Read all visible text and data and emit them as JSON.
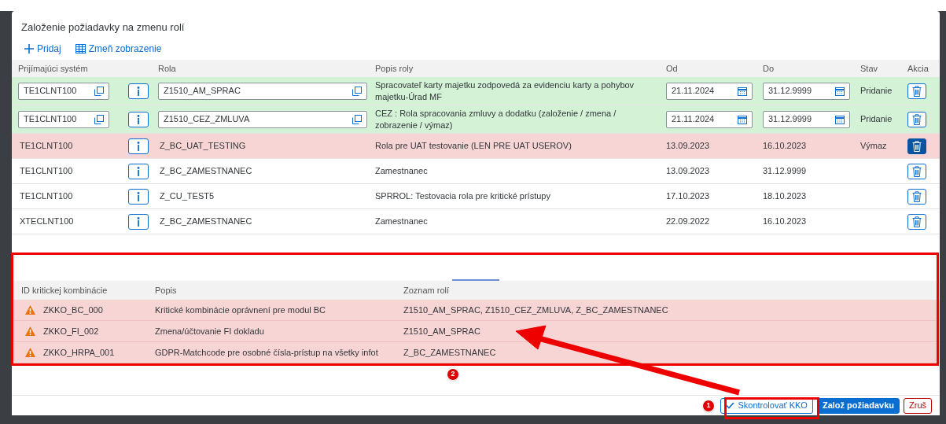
{
  "dialog": {
    "title": "Založenie požiadavky na zmenu rolí",
    "toolbar": [
      {
        "kind": "add",
        "label": "Pridaj"
      },
      {
        "kind": "view",
        "label": "Zmeň zobrazenie"
      }
    ],
    "roles_table": {
      "columns": [
        "Prijímajúci systém",
        "Rola",
        "Popis roly",
        "Od",
        "Do",
        "Stav",
        "Akcia"
      ],
      "rows": [
        {
          "kind": "added",
          "system": "TE1CLNT100",
          "role": "Z1510_AM_SPRAC",
          "description": "Spracovateľ karty majetku zodpovedá za evidenciu karty a pohybov majetku-Úrad MF",
          "from": "21.11.2024",
          "to": "31.12.9999",
          "state": "Pridanie",
          "delete_pressed": false
        },
        {
          "kind": "added",
          "system": "TE1CLNT100",
          "role": "Z1510_CEZ_ZMLUVA",
          "description": "CEZ : Rola spracovania zmluvy a dodatku (založenie / zmena / zobrazenie / výmaz)",
          "from": "21.11.2024",
          "to": "31.12.9999",
          "state": "Pridanie",
          "delete_pressed": false
        },
        {
          "kind": "removed",
          "system": "TE1CLNT100",
          "role": "Z_BC_UAT_TESTING",
          "description": "Rola pre UAT testovanie (LEN PRE UAT USEROV)",
          "from": "13.09.2023",
          "to": "16.10.2023",
          "state": "Výmaz",
          "delete_pressed": true
        },
        {
          "kind": "existing",
          "system": "TE1CLNT100",
          "role": "Z_BC_ZAMESTNANEC",
          "description": "Zamestnanec",
          "from": "13.09.2023",
          "to": "31.12.9999",
          "delete_pressed": false
        },
        {
          "kind": "existing",
          "system": "TE1CLNT100",
          "role": "Z_CU_TEST5",
          "description": "SPRROL: Testovacia rola pre kritické prístupy",
          "from": "17.10.2023",
          "to": "18.10.2023",
          "delete_pressed": false
        },
        {
          "kind": "existing",
          "system": "XTECLNT100",
          "role": "Z_BC_ZAMESTNANEC",
          "description": "Zamestnanec",
          "from": "22.09.2022",
          "to": "16.10.2023",
          "delete_pressed": false
        }
      ]
    },
    "critical_table": {
      "columns": [
        "ID kritickej kombinácie",
        "Popis",
        "Zoznam rolí"
      ],
      "rows": [
        {
          "id": "ZKKO_BC_000",
          "description": "Kritické kombinácie oprávnení pre modul BC",
          "roles": "Z1510_AM_SPRAC, Z1510_CEZ_ZMLUVA, Z_BC_ZAMESTNANEC"
        },
        {
          "id": "ZKKO_FI_002",
          "description": "Zmena/účtovanie FI dokladu",
          "roles": "Z1510_AM_SPRAC"
        },
        {
          "id": "ZKKO_HRPA_001",
          "description": "GDPR-Matchcode pre osobné čísla-prístup na všetky infot",
          "roles": "Z_BC_ZAMESTNANEC"
        }
      ]
    },
    "footer_buttons": [
      {
        "kind": "check",
        "label": "Skontrolovať KKO"
      },
      {
        "kind": "primary",
        "label": "Založ požiadavku"
      },
      {
        "kind": "reject",
        "label": "Zruš"
      }
    ]
  },
  "annotations": [
    {
      "label": "1"
    },
    {
      "label": "2"
    }
  ]
}
